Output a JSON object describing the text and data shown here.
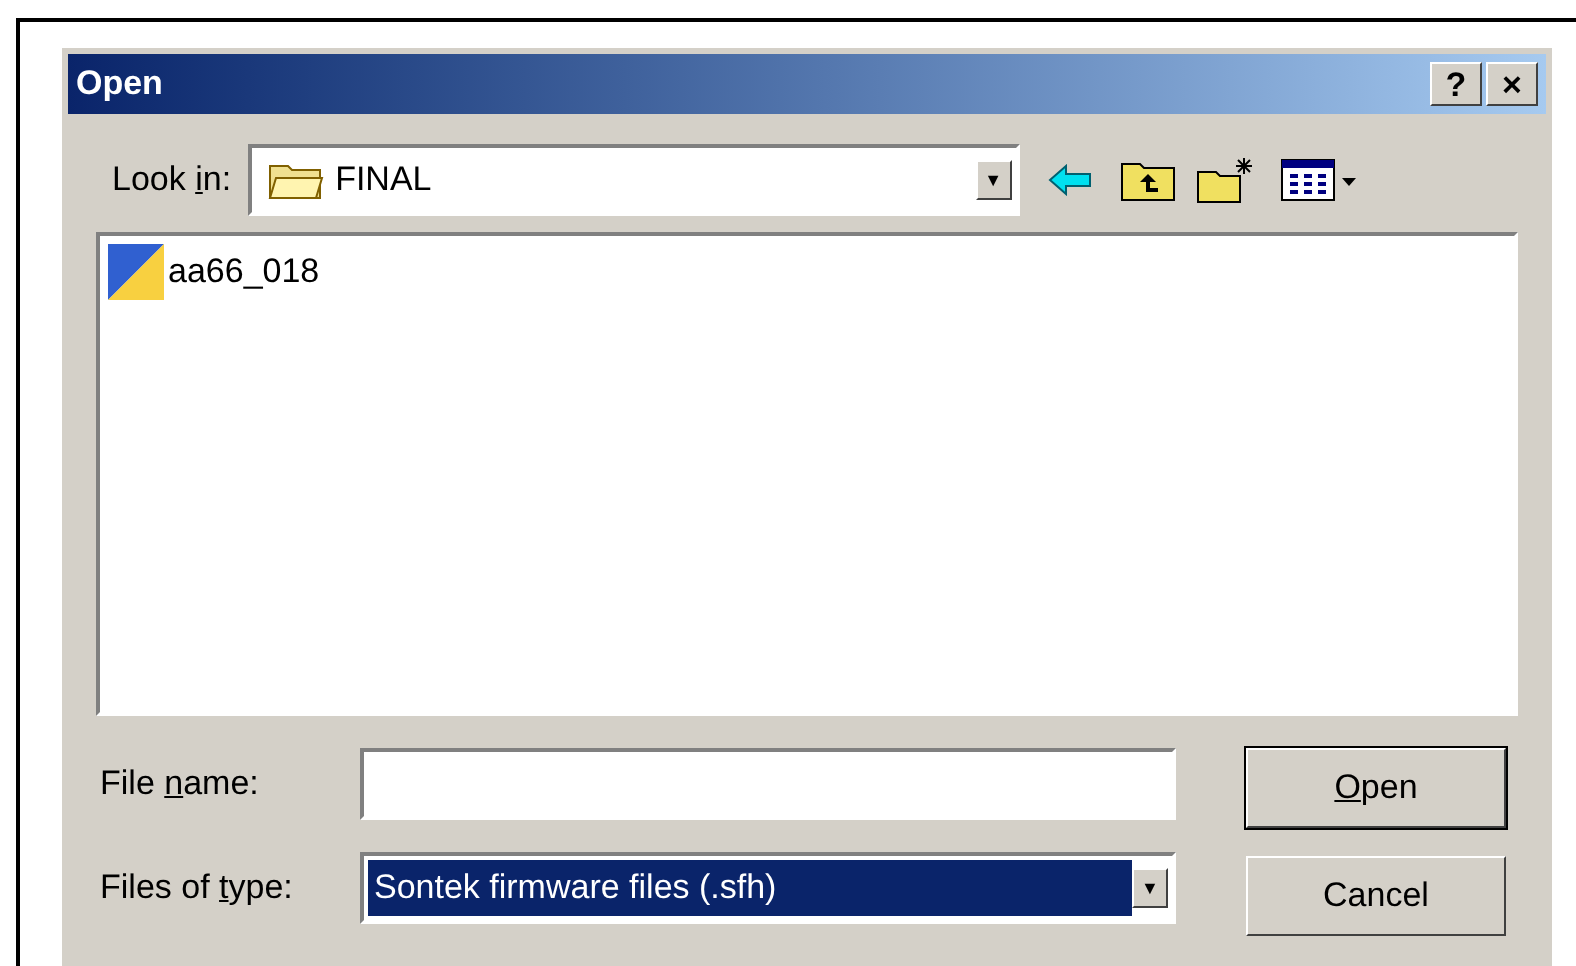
{
  "window": {
    "title": "Open",
    "title_buttons": [
      "?",
      "×"
    ]
  },
  "look_in": {
    "label": {
      "before": "Look ",
      "key": "i",
      "after": "n:"
    },
    "value": "FINAL",
    "arrow": "▼"
  },
  "files": [
    {
      "name": "aa66_018",
      "selected": false
    }
  ],
  "file_name": {
    "label": {
      "before": "File ",
      "key": "n",
      "after": "ame:"
    }
  },
  "file_type": {
    "label": {
      "before": "Files of ",
      "key": "t",
      "after": "ype:"
    },
    "value": "Sontek firmware files (.sfh)",
    "arrow": "▼"
  },
  "buttons": [
    {
      "label": {
        "key": "O",
        "after": "pen"
      },
      "default": true
    },
    {
      "label": {
        "before": "Cancel"
      },
      "default": false
    }
  ]
}
